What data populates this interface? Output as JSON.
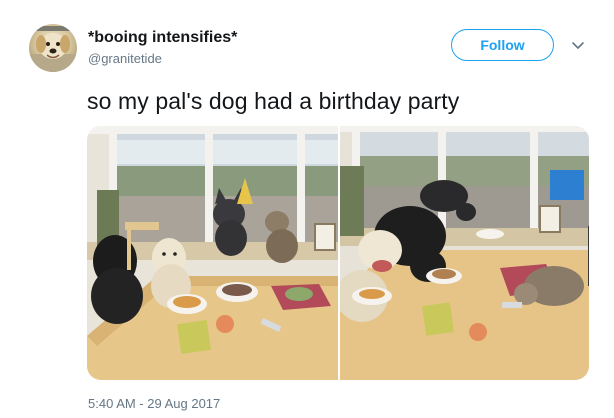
{
  "tweet": {
    "display_name": "*booing intensifies*",
    "handle": "@granitetide",
    "follow_label": "Follow",
    "text": "so my pal's dog had a birthday party",
    "timestamp": "5:40 AM - 29 Aug 2017"
  },
  "colors": {
    "accent": "#1da1f2",
    "text_primary": "#14171a",
    "text_secondary": "#657786"
  },
  "icons": {
    "caret": "chevron-down-icon"
  }
}
